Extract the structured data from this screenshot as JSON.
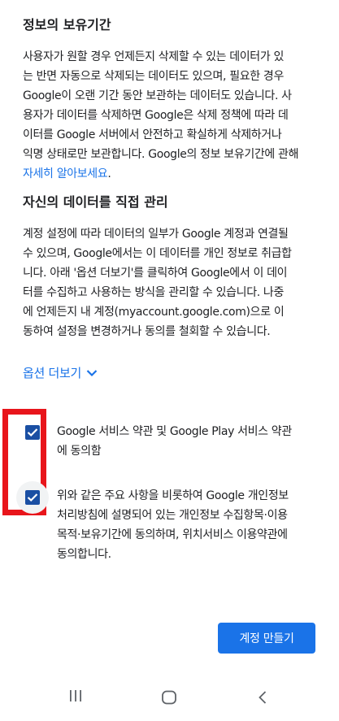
{
  "retention": {
    "title": "정보의 보유기간",
    "lines": [
      "사용자가 원할 경우 언제든지 삭제할 수 있는 데이터가 있",
      "는 반면 자동으로 삭제되는 데이터도 있으며, 필요한 경우",
      "Google이 오랜 기간 동안 보관하는 데이터도 있습니다. 사",
      "용자가 데이터를 삭제하면 Google은 삭제 정책에 따라 데",
      "이터를 Google 서버에서 안전하고 확실하게 삭제하거나",
      "익명 상태로만 보관합니다. Google의 정보 보유기간에 관해"
    ],
    "link": "자세히 알아보세요",
    "link_suffix": "."
  },
  "manage": {
    "title": "자신의 데이터를 직접 관리",
    "lines": [
      "계정 설정에 따라 데이터의 일부가 Google 계정과 연결될",
      "수 있으며, Google에서는 이 데이터를 개인 정보로 취급합",
      "니다. 아래 '옵션 더보기'를 클릭하여 Google에서 이 데이",
      "터를 수집하고 사용하는 방식을 관리할 수 있습니다. 나중",
      "에 언제든지 내 계정(myaccount.google.com)으로 이",
      "동하여 설정을 변경하거나 동의를 철회할 수 있습니다."
    ]
  },
  "more_options": "옵션 더보기",
  "checkboxes": [
    {
      "checked": true,
      "lines": [
        "Google 서비스 약관 및 Google Play 서비스 약관",
        "에 동의함"
      ]
    },
    {
      "checked": true,
      "lines": [
        "위와 같은 주요 사항을 비롯하여 Google 개인정보",
        "처리방침에 설명되어 있는 개인정보 수집항목·이용",
        "목적·보유기간에 동의하며, 위치서비스 이용약관에",
        "동의합니다."
      ]
    }
  ],
  "create_account_button": "계정 만들기",
  "colors": {
    "accent": "#1a73e8",
    "checkbox": "#1a4fa3",
    "highlight": "#e8151b"
  },
  "icons": [
    "chevron-down-icon",
    "check-icon",
    "recent-apps-icon",
    "home-icon",
    "back-icon"
  ]
}
